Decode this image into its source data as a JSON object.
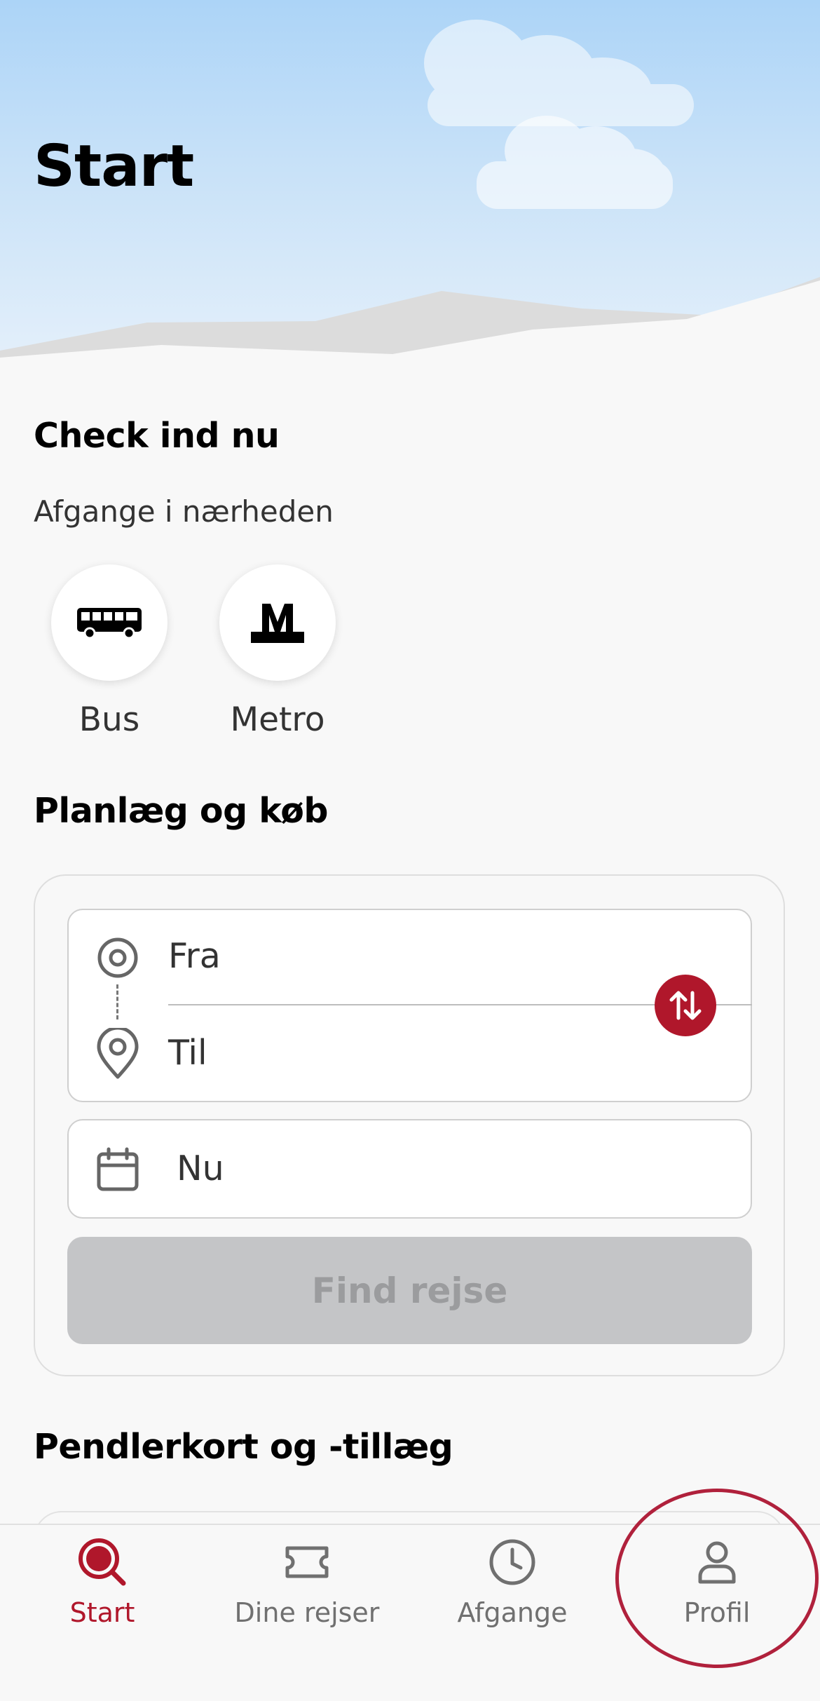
{
  "header": {
    "title": "Start"
  },
  "check_in": {
    "title": "Check ind nu",
    "subtitle": "Afgange i nærheden",
    "options": [
      {
        "label": "Bus",
        "icon": "bus-icon"
      },
      {
        "label": "Metro",
        "icon": "metro-icon"
      }
    ]
  },
  "plan": {
    "title": "Planlæg og køb",
    "from_placeholder": "Fra",
    "to_placeholder": "Til",
    "time_value": "Nu",
    "find_button": "Find rejse"
  },
  "commuter": {
    "title": "Pendlerkort og -tillæg"
  },
  "tabs": [
    {
      "label": "Start",
      "icon": "search-icon",
      "active": true
    },
    {
      "label": "Dine rejser",
      "icon": "ticket-icon",
      "active": false
    },
    {
      "label": "Afgange",
      "icon": "clock-icon",
      "active": false
    },
    {
      "label": "Profil",
      "icon": "person-icon",
      "active": false
    }
  ],
  "colors": {
    "accent": "#b0172b",
    "sky_top": "#acd4f7",
    "button_disabled": "#c4c5c7",
    "background": "#f8f8f8"
  }
}
